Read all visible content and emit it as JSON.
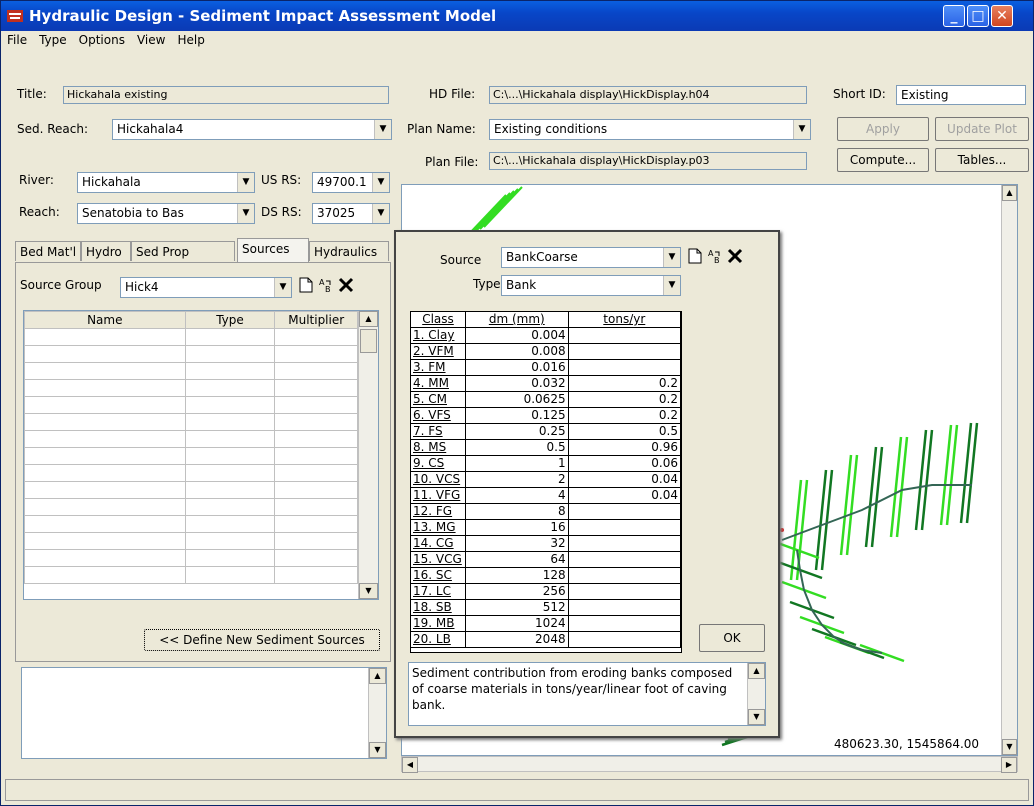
{
  "window": {
    "title": "Hydraulic Design - Sediment Impact Assessment Model"
  },
  "menu": [
    {
      "label": "File"
    },
    {
      "label": "Type"
    },
    {
      "label": "Options"
    },
    {
      "label": "View"
    },
    {
      "label": "Help"
    }
  ],
  "form": {
    "title_label": "Title:",
    "title_value": "Hickahala existing",
    "sed_reach_label": "Sed. Reach:",
    "sed_reach_value": "Hickahala4",
    "river_label": "River:",
    "river_value": "Hickahala",
    "reach_label": "Reach:",
    "reach_value": "Senatobia to Bas",
    "us_rs_label": "US RS:",
    "us_rs_value": "49700.1",
    "ds_rs_label": "DS RS:",
    "ds_rs_value": "37025",
    "hd_file_label": "HD File:",
    "hd_file_value": "C:\\...\\Hickahala display\\HickDisplay.h04",
    "plan_name_label": "Plan Name:",
    "plan_name_value": "Existing conditions",
    "plan_file_label": "Plan File:",
    "plan_file_value": "C:\\...\\Hickahala display\\HickDisplay.p03",
    "short_id_label": "Short ID:",
    "short_id_value": "Existing"
  },
  "buttons": {
    "apply": "Apply",
    "update_plot": "Update Plot",
    "compute": "Compute...",
    "tables": "Tables...",
    "define_sources": "<< Define New Sediment Sources",
    "ok": "OK"
  },
  "tabs": [
    {
      "label": "Bed Mat'l"
    },
    {
      "label": "Hydro"
    },
    {
      "label": "Sed Prop"
    },
    {
      "label": "Sources"
    },
    {
      "label": "Hydraulics"
    }
  ],
  "sources_panel": {
    "source_group_label": "Source Group",
    "source_group_value": "Hick4",
    "columns": [
      "Name",
      "Type",
      "Multiplier"
    ]
  },
  "plot": {
    "coordinates": "480623.30, 1545864.00"
  },
  "dialog": {
    "source_label": "Source",
    "source_value": "BankCoarse",
    "type_label": "Type",
    "type_value": "Bank",
    "columns": [
      "Class",
      "dm (mm)",
      "tons/yr"
    ],
    "rows": [
      {
        "cls": "1. Clay",
        "dm": "0.004",
        "tons": ""
      },
      {
        "cls": "2. VFM",
        "dm": "0.008",
        "tons": ""
      },
      {
        "cls": "3. FM",
        "dm": "0.016",
        "tons": ""
      },
      {
        "cls": "4. MM",
        "dm": "0.032",
        "tons": "0.2"
      },
      {
        "cls": "5. CM",
        "dm": "0.0625",
        "tons": "0.2"
      },
      {
        "cls": "6. VFS",
        "dm": "0.125",
        "tons": "0.2"
      },
      {
        "cls": "7. FS",
        "dm": "0.25",
        "tons": "0.5"
      },
      {
        "cls": "8. MS",
        "dm": "0.5",
        "tons": "0.96"
      },
      {
        "cls": "9. CS",
        "dm": "1",
        "tons": "0.06"
      },
      {
        "cls": "10. VCS",
        "dm": "2",
        "tons": "0.04"
      },
      {
        "cls": "11. VFG",
        "dm": "4",
        "tons": "0.04"
      },
      {
        "cls": "12. FG",
        "dm": "8",
        "tons": ""
      },
      {
        "cls": "13. MG",
        "dm": "16",
        "tons": ""
      },
      {
        "cls": "14. CG",
        "dm": "32",
        "tons": ""
      },
      {
        "cls": "15. VCG",
        "dm": "64",
        "tons": ""
      },
      {
        "cls": "16. SC",
        "dm": "128",
        "tons": ""
      },
      {
        "cls": "17. LC",
        "dm": "256",
        "tons": ""
      },
      {
        "cls": "18. SB",
        "dm": "512",
        "tons": ""
      },
      {
        "cls": "19. MB",
        "dm": "1024",
        "tons": ""
      },
      {
        "cls": "20. LB",
        "dm": "2048",
        "tons": ""
      }
    ],
    "description": "Sediment contribution from eroding banks composed of coarse materials in tons/year/linear foot of caving bank."
  },
  "colors": {
    "titlebar": "#0846c8",
    "xs_light": "#33dd22",
    "xs_dark": "#117722",
    "river_line": "#336655"
  }
}
